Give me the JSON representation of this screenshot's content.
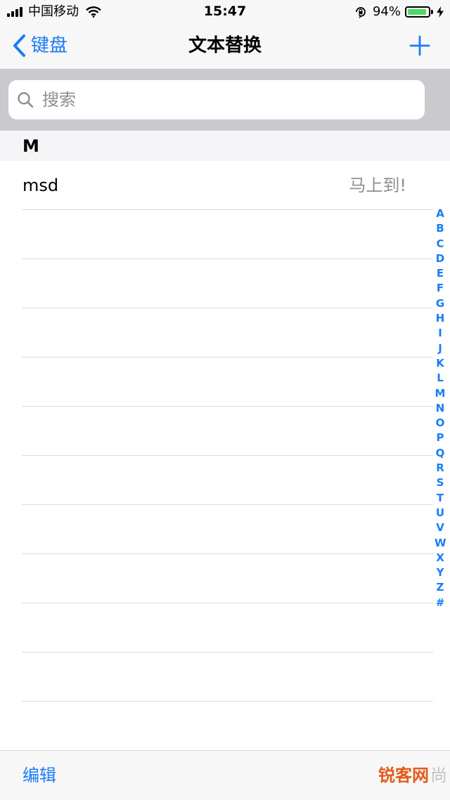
{
  "status_bar": {
    "carrier": "中国移动",
    "time": "15:47",
    "battery_percent": "94%",
    "battery_level": 0.94,
    "icons": [
      "signal-icon",
      "wifi-icon",
      "rotation-lock-icon",
      "battery-icon",
      "charging-icon"
    ]
  },
  "nav": {
    "back_label": "键盘",
    "title": "文本替换",
    "add_icon": "plus-icon"
  },
  "search": {
    "placeholder": "搜索",
    "value": ""
  },
  "section": {
    "letter": "M"
  },
  "rows": [
    {
      "shortcut": "msd",
      "phrase": "马上到!"
    },
    {
      "shortcut": "",
      "phrase": ""
    },
    {
      "shortcut": "",
      "phrase": ""
    },
    {
      "shortcut": "",
      "phrase": ""
    },
    {
      "shortcut": "",
      "phrase": ""
    },
    {
      "shortcut": "",
      "phrase": ""
    },
    {
      "shortcut": "",
      "phrase": ""
    },
    {
      "shortcut": "",
      "phrase": ""
    },
    {
      "shortcut": "",
      "phrase": ""
    },
    {
      "shortcut": "",
      "phrase": ""
    },
    {
      "shortcut": "",
      "phrase": ""
    },
    {
      "shortcut": "",
      "phrase": ""
    }
  ],
  "index": [
    "A",
    "B",
    "C",
    "D",
    "E",
    "F",
    "G",
    "H",
    "I",
    "J",
    "K",
    "L",
    "M",
    "N",
    "O",
    "P",
    "Q",
    "R",
    "S",
    "T",
    "U",
    "V",
    "W",
    "X",
    "Y",
    "Z",
    "#"
  ],
  "toolbar": {
    "edit_label": "编辑"
  },
  "watermark": {
    "brand": "锐客网",
    "tail": "尚"
  },
  "colors": {
    "accent": "#1a7cf5",
    "battery": "#4cd964",
    "secondary_text": "#8e8e93",
    "search_bg": "#c9c9ce"
  }
}
